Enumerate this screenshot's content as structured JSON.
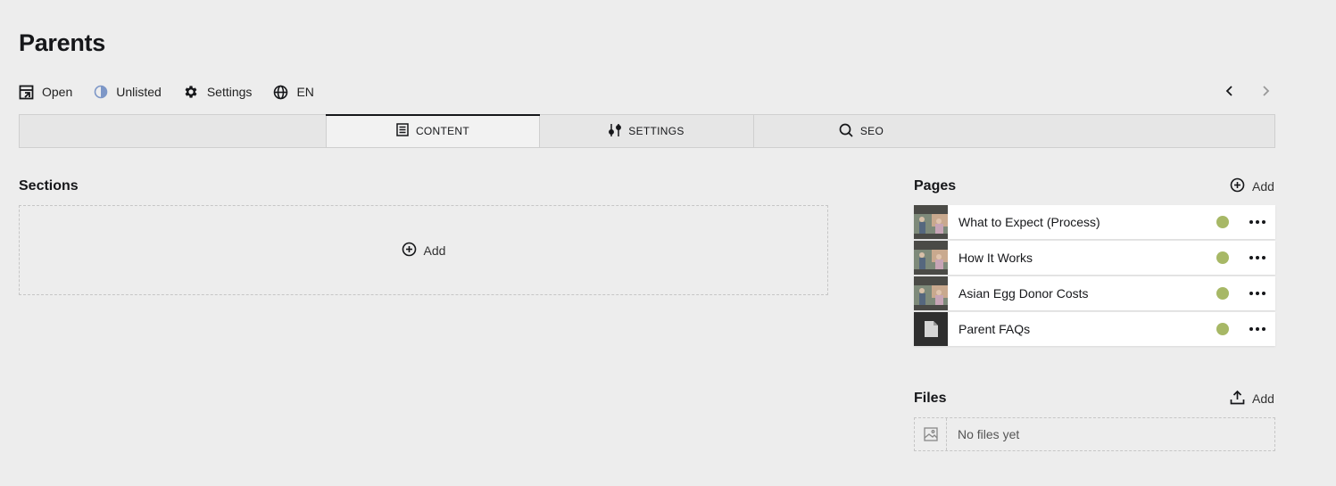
{
  "page": {
    "title": "Parents"
  },
  "header_actions": {
    "open": "Open",
    "status": "Unlisted",
    "settings": "Settings",
    "language": "EN"
  },
  "tabs": [
    {
      "label": ""
    },
    {
      "label": "CONTENT",
      "icon": "document-icon",
      "active": true
    },
    {
      "label": "SETTINGS",
      "icon": "sliders-icon"
    },
    {
      "label": "SEO",
      "icon": "search-icon"
    }
  ],
  "sections": {
    "label": "Sections",
    "add_label": "Add"
  },
  "pages": {
    "label": "Pages",
    "add_label": "Add",
    "items": [
      {
        "title": "What to Expect (Process)",
        "status": "listed",
        "status_color": "#a7b866",
        "thumb": "photo"
      },
      {
        "title": "How It Works",
        "status": "listed",
        "status_color": "#a7b866",
        "thumb": "photo"
      },
      {
        "title": "Asian Egg Donor Costs",
        "status": "listed",
        "status_color": "#a7b866",
        "thumb": "photo"
      },
      {
        "title": "Parent FAQs",
        "status": "listed",
        "status_color": "#a7b866",
        "thumb": "file"
      }
    ]
  },
  "files": {
    "label": "Files",
    "add_label": "Add",
    "empty_text": "No files yet"
  },
  "colors": {
    "background": "#ededed",
    "status_listed": "#a7b866",
    "accent": "#16171a"
  }
}
